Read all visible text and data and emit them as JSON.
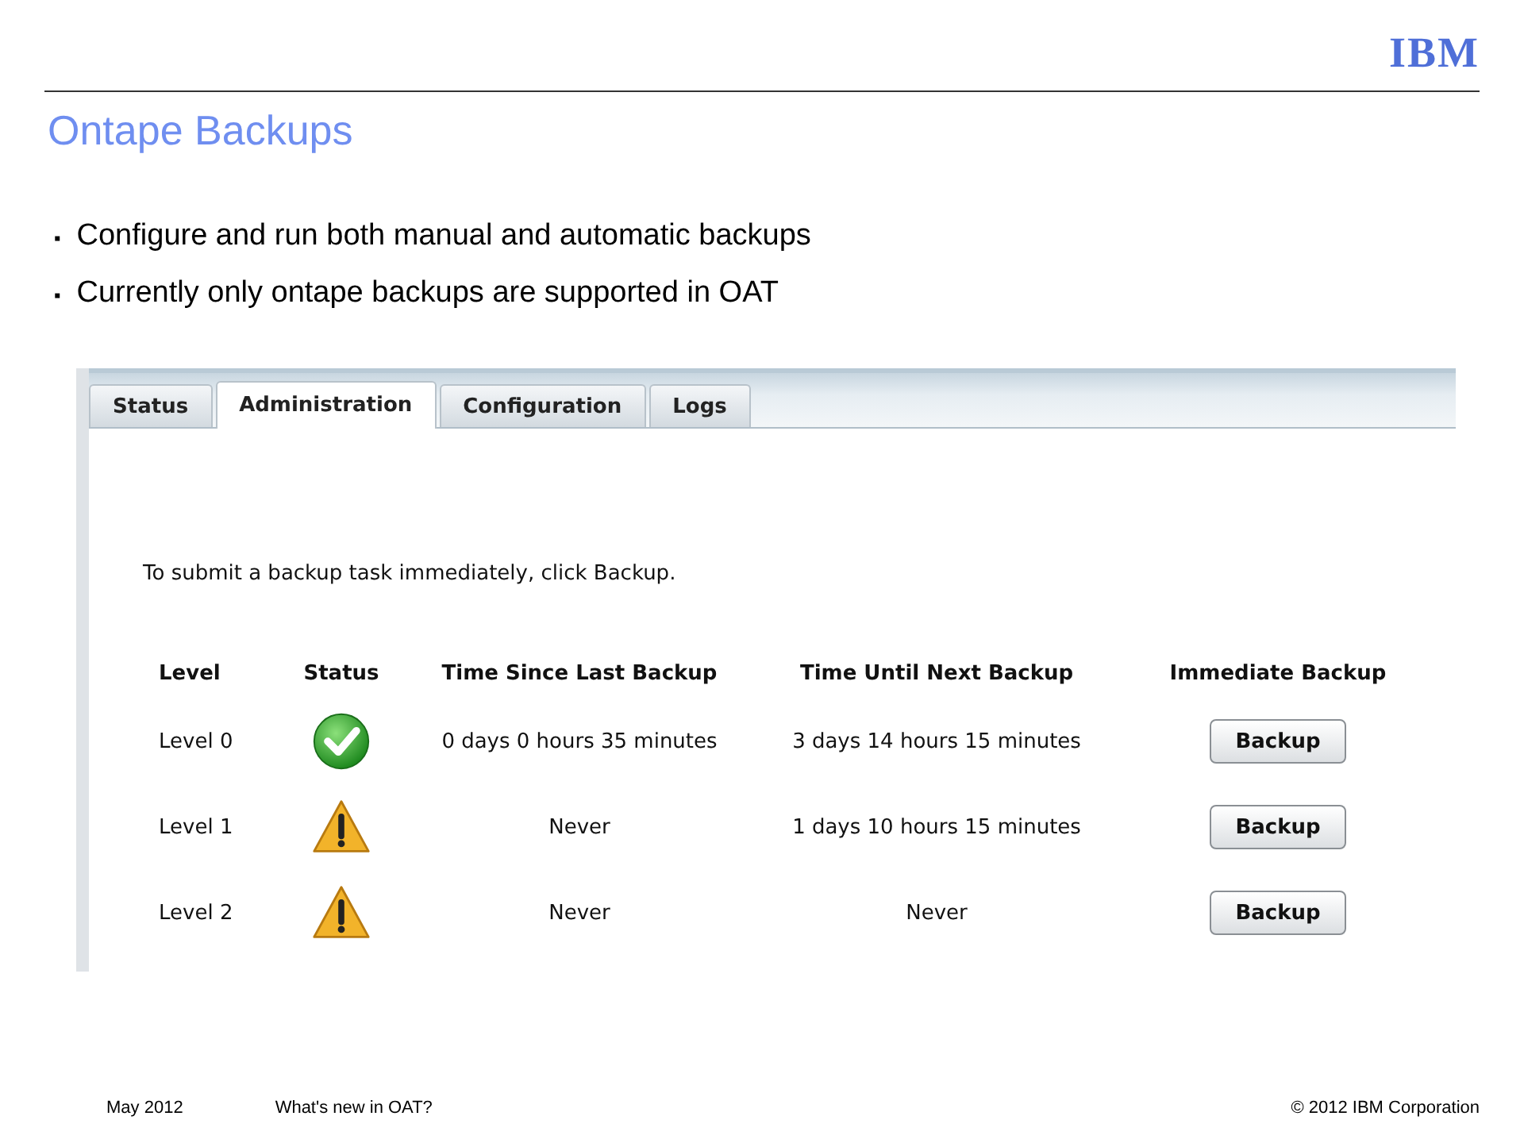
{
  "logo": "IBM",
  "title": "Ontape Backups",
  "bullets": [
    {
      "marker": "▪",
      "text": "Configure and run both manual and automatic backups"
    },
    {
      "marker": "▪",
      "text": "Currently only ontape backups are supported in OAT"
    }
  ],
  "screenshot": {
    "tabs": [
      {
        "label": "Status",
        "selected": false
      },
      {
        "label": "Administration",
        "selected": true
      },
      {
        "label": "Configuration",
        "selected": false
      },
      {
        "label": "Logs",
        "selected": false
      }
    ],
    "instruction": "To submit a backup task immediately, click Backup.",
    "table": {
      "columns": [
        "Level",
        "Status",
        "Time Since Last Backup",
        "Time Until Next Backup",
        "Immediate Backup"
      ],
      "rows": [
        {
          "level": "Level 0",
          "kind": "ok",
          "since": "0 days 0 hours 35 minutes",
          "until": "3 days 14 hours 15 minutes",
          "button": "Backup"
        },
        {
          "level": "Level 1",
          "kind": "warning",
          "since": "Never",
          "until": "1 days 10 hours 15 minutes",
          "button": "Backup"
        },
        {
          "level": "Level 2",
          "kind": "warning",
          "since": "Never",
          "until": "Never",
          "button": "Backup"
        }
      ]
    }
  },
  "footer": {
    "date": "May 2012",
    "subject": "What's new in OAT?",
    "copyright": "© 2012 IBM Corporation"
  }
}
